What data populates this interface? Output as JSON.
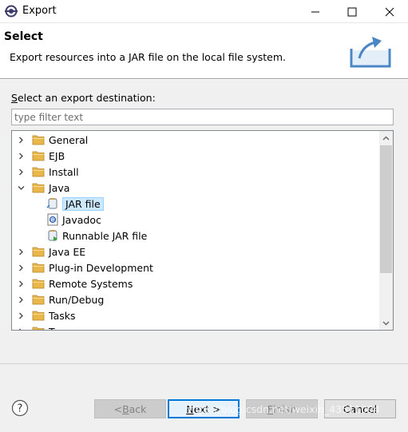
{
  "window": {
    "title": "Export"
  },
  "header": {
    "title": "Select",
    "description": "Export resources into a JAR file on the local file system."
  },
  "destination": {
    "label": "Select an export destination:",
    "filter_placeholder": "type filter text"
  },
  "tree": {
    "items": [
      {
        "label": "General",
        "expanded": false
      },
      {
        "label": "EJB",
        "expanded": false
      },
      {
        "label": "Install",
        "expanded": false
      },
      {
        "label": "Java",
        "expanded": true
      },
      {
        "label": "JAR file",
        "child": true,
        "selected": true
      },
      {
        "label": "Javadoc",
        "child": true
      },
      {
        "label": "Runnable JAR file",
        "child": true
      },
      {
        "label": "Java EE",
        "expanded": false
      },
      {
        "label": "Plug-in Development",
        "expanded": false
      },
      {
        "label": "Remote Systems",
        "expanded": false
      },
      {
        "label": "Run/Debug",
        "expanded": false
      },
      {
        "label": "Tasks",
        "expanded": false
      },
      {
        "label": "Team",
        "expanded": false
      }
    ]
  },
  "buttons": {
    "back": {
      "mnemonic": "B",
      "rest": "ack",
      "prefix": "< "
    },
    "next": {
      "mnemonic": "N",
      "rest": "ext >"
    },
    "finish": {
      "mnemonic": "F",
      "rest": "inish"
    },
    "cancel": "Cancel"
  },
  "watermark": "https://blog.csdn.net/weixin_43511094",
  "colors": {
    "selection": "#cce8ff",
    "default_button_border": "#0078d7",
    "folder": "#e8b84a"
  }
}
